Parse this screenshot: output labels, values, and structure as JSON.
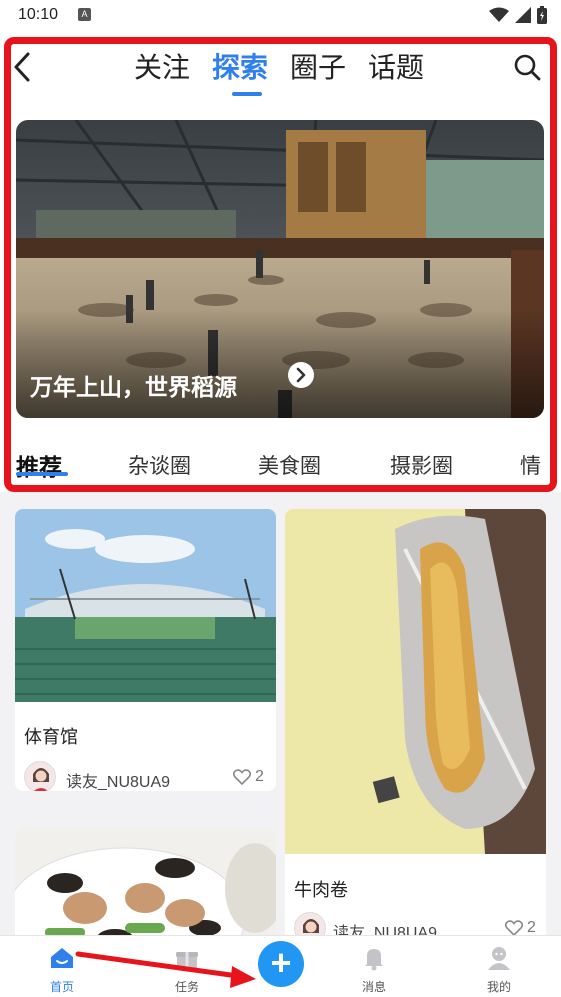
{
  "status_bar": {
    "time": "10:10",
    "notif_icon": "A"
  },
  "top_nav": {
    "tabs": [
      "关注",
      "探索",
      "圈子",
      "话题"
    ],
    "active_index": 1
  },
  "banner": {
    "caption": "万年上山，世界稻源"
  },
  "categories": [
    "推荐",
    "杂谈圈",
    "美食圈",
    "摄影圈",
    "情"
  ],
  "feed": [
    {
      "title": "体育馆",
      "user": "读友_NU8UA9",
      "likes": "2"
    },
    {
      "title": "牛肉卷",
      "user": "读友_NU8UA9",
      "likes": "2"
    }
  ],
  "bottom_nav": {
    "home": "首页",
    "tasks": "任务",
    "messages": "消息",
    "mine": "我的"
  },
  "colors": {
    "accent": "#2f80ed",
    "highlight": "#e8141c",
    "publish": "#2196f3"
  },
  "icons": [
    "back-icon",
    "search-icon",
    "heart-icon",
    "home-icon",
    "gift-icon",
    "bell-icon",
    "person-icon",
    "plus-icon"
  ]
}
